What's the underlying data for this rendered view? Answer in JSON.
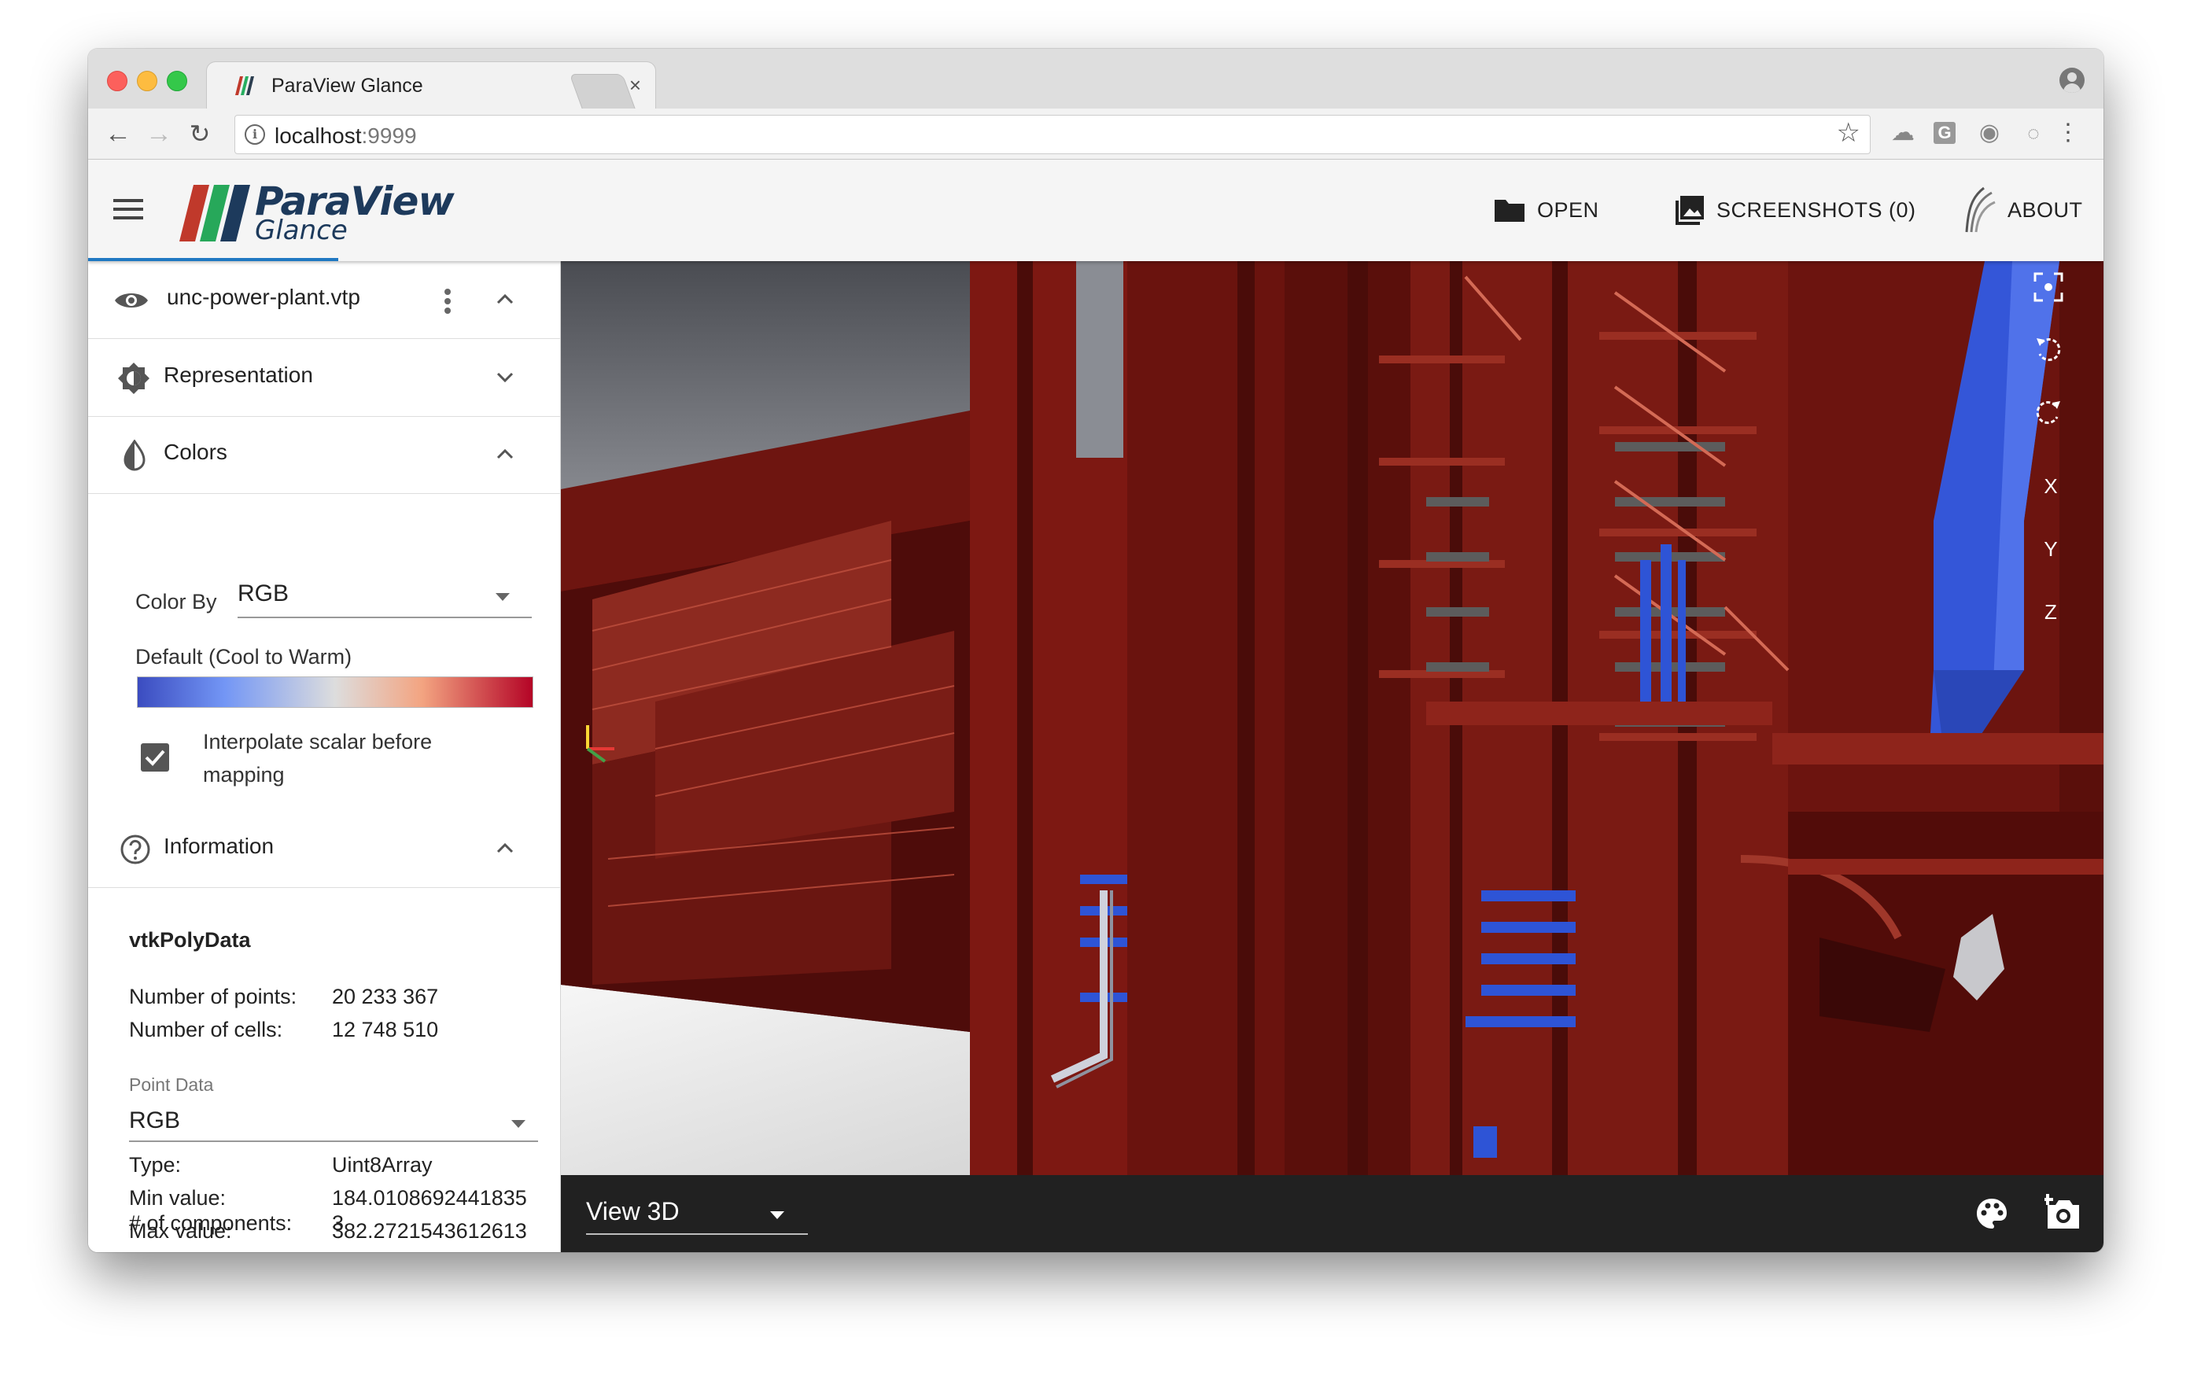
{
  "browser": {
    "tab_title": "ParaView Glance",
    "tab_close": "×",
    "url_host": "localhost",
    "url_port": ":9999"
  },
  "app": {
    "logo_title": "ParaView",
    "logo_sub": "Glance",
    "buttons": {
      "open": "OPEN",
      "screenshots": "SCREENSHOTS (0)",
      "about": "ABOUT"
    }
  },
  "sidebar": {
    "file_name": "unc-power-plant.vtp",
    "sections": {
      "representation": "Representation",
      "colors": "Colors",
      "information": "Information"
    },
    "colors": {
      "color_by_label": "Color By",
      "color_by_value": "RGB",
      "preset_name": "Default (Cool to Warm)",
      "interpolate_line1": "Interpolate scalar before",
      "interpolate_line2": "mapping",
      "interpolate_checked": true
    },
    "information": {
      "data_type": "vtkPolyData",
      "points_label": "Number of points:",
      "points_value": "20 233 367",
      "cells_label": "Number of cells:",
      "cells_value": "12 748 510",
      "point_data_label": "Point Data",
      "point_data_value": "RGB",
      "type_label": "Type:",
      "type_value": "Uint8Array",
      "min_label": "Min value:",
      "min_value": "184.0108692441835",
      "max_label": "Max value:",
      "max_value": "382.2721543612613",
      "components_label": "# of components:",
      "components_value": "3"
    }
  },
  "view": {
    "axis_buttons": {
      "x": "X",
      "y": "Y",
      "z": "Z"
    },
    "view_type": "View 3D"
  },
  "colors": {
    "accent": "#1f78c2",
    "scene_red": "#8b1a14",
    "scene_blue": "#2e54d6",
    "colormap_cool": "#3b4cc0",
    "colormap_mid": "#dddddd",
    "colormap_warm": "#b40426"
  }
}
